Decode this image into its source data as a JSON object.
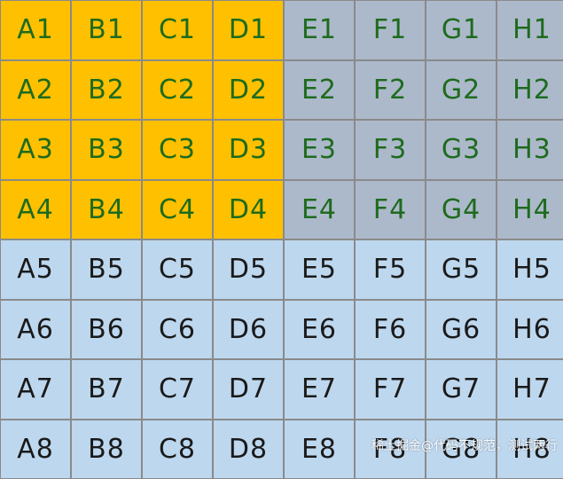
{
  "colors": {
    "orange": "#ffc000",
    "gray_blue": "#acb9ca",
    "light_blue": "#bdd7ee",
    "green_text": "#1e6b1e",
    "dark_text": "#1a1a1a",
    "grid_line": "#8a8a8a"
  },
  "grid": {
    "columns": [
      "A",
      "B",
      "C",
      "D",
      "E",
      "F",
      "G",
      "H"
    ],
    "rows": [
      [
        "A1",
        "B1",
        "C1",
        "D1",
        "E1",
        "F1",
        "G1",
        "H1"
      ],
      [
        "A2",
        "B2",
        "C2",
        "D2",
        "E2",
        "F2",
        "G2",
        "H2"
      ],
      [
        "A3",
        "B3",
        "C3",
        "D3",
        "E3",
        "F3",
        "G3",
        "H3"
      ],
      [
        "A4",
        "B4",
        "C4",
        "D4",
        "E4",
        "F4",
        "G4",
        "H4"
      ],
      [
        "A5",
        "B5",
        "C5",
        "D5",
        "E5",
        "F5",
        "G5",
        "H5"
      ],
      [
        "A6",
        "B6",
        "C6",
        "D6",
        "E6",
        "F6",
        "G6",
        "H6"
      ],
      [
        "A7",
        "B7",
        "C7",
        "D7",
        "E7",
        "F7",
        "G7",
        "H7"
      ],
      [
        "A8",
        "B8",
        "C8",
        "D8",
        "E8",
        "F8",
        "G8",
        "H8"
      ]
    ]
  },
  "watermark": {
    "text": "稀土掘金@代码不规范，测试两行"
  }
}
